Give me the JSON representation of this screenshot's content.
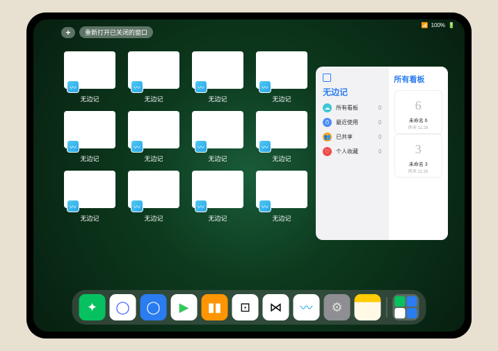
{
  "status": {
    "battery": "100%",
    "signal": "•••"
  },
  "topbar": {
    "plus": "+",
    "reopen_label": "重新打开已关闭的窗口"
  },
  "app_name": "无边记",
  "tiles": [
    {
      "style": "blank"
    },
    {
      "style": "grid"
    },
    {
      "style": "grid"
    },
    {
      "style": "blank"
    },
    {
      "style": "grid"
    },
    {
      "style": "grid"
    },
    {
      "style": "blank"
    },
    {
      "style": "grid"
    },
    {
      "style": "grid"
    },
    {
      "style": "blank"
    },
    {
      "style": "blank"
    },
    {
      "style": "grid"
    }
  ],
  "panel": {
    "title": "无边记",
    "ellipsis": "•••",
    "right_title": "所有看板",
    "items": [
      {
        "icon_color": "#3bc7d6",
        "label": "所有看板",
        "count": "0",
        "glyph": "☁"
      },
      {
        "icon_color": "#4a8cf5",
        "label": "最近使用",
        "count": "0",
        "glyph": "⏱"
      },
      {
        "icon_color": "#f5a623",
        "label": "已共享",
        "count": "0",
        "glyph": "👥"
      },
      {
        "icon_color": "#f04a4a",
        "label": "个人收藏",
        "count": "0",
        "glyph": "♡"
      }
    ],
    "boards": [
      {
        "glyph": "6",
        "label": "未命名 6",
        "sub": "昨天 11:28"
      },
      {
        "glyph": "3",
        "label": "未命名 3",
        "sub": "昨天 11:26"
      }
    ]
  },
  "dock": [
    {
      "name": "wechat",
      "bg": "#07c160",
      "glyph": "✦",
      "fg": "#fff"
    },
    {
      "name": "quark",
      "bg": "#ffffff",
      "glyph": "◯",
      "fg": "#3355ff"
    },
    {
      "name": "qqbrowser",
      "bg": "#2a7cf0",
      "glyph": "◯",
      "fg": "#fff"
    },
    {
      "name": "play",
      "bg": "#ffffff",
      "glyph": "▶",
      "fg": "#34c759"
    },
    {
      "name": "books",
      "bg": "#ff9500",
      "glyph": "▮▮",
      "fg": "#fff"
    },
    {
      "name": "dice",
      "bg": "#ffffff",
      "glyph": "⊡",
      "fg": "#000"
    },
    {
      "name": "connect",
      "bg": "#ffffff",
      "glyph": "⋈",
      "fg": "#000"
    },
    {
      "name": "freeform",
      "bg": "#ffffff",
      "glyph": "〰",
      "fg": "#2aa7e8"
    },
    {
      "name": "settings",
      "bg": "#8e8e93",
      "glyph": "⚙",
      "fg": "#e0e0e0"
    },
    {
      "name": "notes",
      "bg": "#fff9e6",
      "glyph": "",
      "fg": "#ffcc00",
      "top": "#ffcc00"
    }
  ]
}
